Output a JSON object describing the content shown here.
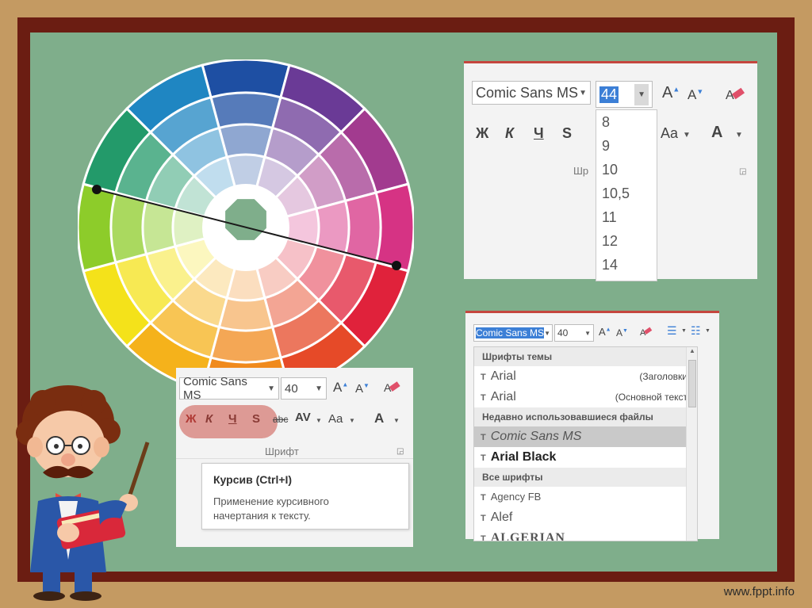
{
  "footer": {
    "url": "www.fppt.info"
  },
  "colors": {
    "frame_outer": "#c49a62",
    "frame_inner": "#6b1d12",
    "board": "#7fae8b",
    "accent_red": "#c5463e"
  },
  "panel_size": {
    "font_name": "Comic Sans MS",
    "font_size": "44",
    "buttons": [
      "Ж",
      "К",
      "Ч",
      "S",
      "Aa",
      "A"
    ],
    "group_label": "Шр",
    "sizes": [
      "8",
      "9",
      "10",
      "10,5",
      "11",
      "12",
      "14"
    ]
  },
  "panel_italic": {
    "font_name": "Comic Sans MS",
    "font_size": "40",
    "buttons": [
      "Ж",
      "К",
      "Ч",
      "S",
      "abc",
      "AV",
      "Aa",
      "A"
    ],
    "group_label": "Шрифт",
    "tooltip": {
      "title": "Курсив (Ctrl+I)",
      "text_line1": "Применение курсивного",
      "text_line2": "начертания к тексту."
    }
  },
  "panel_fonts": {
    "font_name": "Comic Sans MS",
    "font_size": "40",
    "sections": [
      {
        "header": "Шрифты темы",
        "items": [
          {
            "name": "Arial",
            "note": "(Заголовки)"
          },
          {
            "name": "Arial",
            "note": "(Основной текст)"
          }
        ]
      },
      {
        "header": "Недавно использовавшиеся файлы",
        "items": [
          {
            "name": "Comic Sans MS",
            "note": ""
          },
          {
            "name": "Arial Black",
            "note": ""
          }
        ]
      },
      {
        "header": "Все шрифты",
        "items": [
          {
            "name": "Agency FB",
            "note": ""
          },
          {
            "name": "Alef",
            "note": ""
          },
          {
            "name": "ALGERIAN",
            "note": ""
          }
        ]
      }
    ]
  }
}
